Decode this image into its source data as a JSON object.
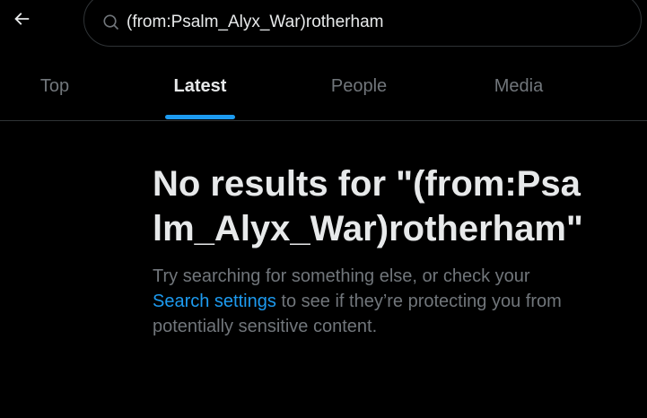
{
  "search": {
    "query": "(from:Psalm_Alyx_War)rotherham"
  },
  "tabs": [
    {
      "label": "Top",
      "active": false
    },
    {
      "label": "Latest",
      "active": true
    },
    {
      "label": "People",
      "active": false
    },
    {
      "label": "Media",
      "active": false
    }
  ],
  "empty_state": {
    "title": "No results for \"(from:Psalm_Alyx_War)rotherham\"",
    "desc_before": "Try searching for something else, or check your ",
    "link": "Search settings",
    "desc_after": " to see if they’re protecting you from potentially sensitive content."
  },
  "icons": {
    "back": "back-arrow-icon",
    "search": "search-icon"
  },
  "colors": {
    "background": "#000000",
    "text": "#e7e9ea",
    "muted": "#71767b",
    "accent": "#1d9bf0",
    "border": "#2f3336"
  }
}
